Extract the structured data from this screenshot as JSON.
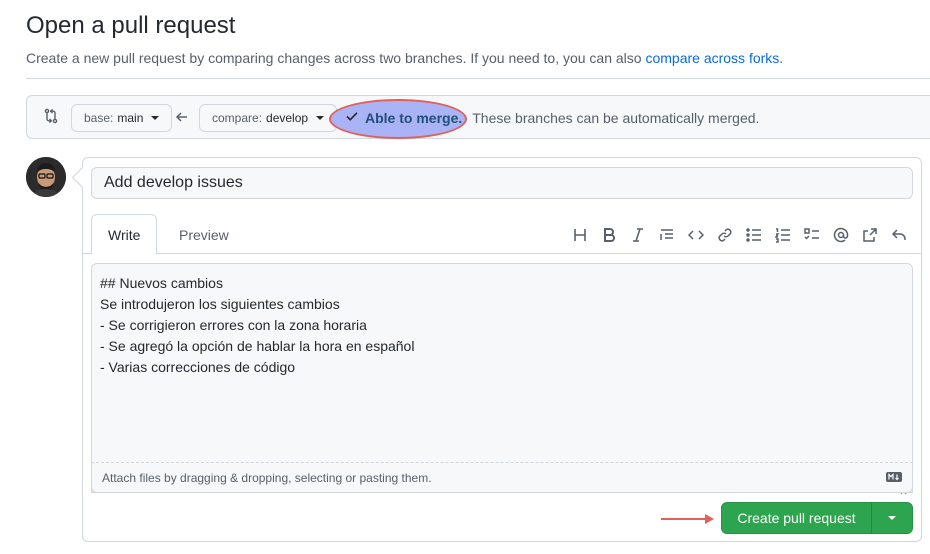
{
  "header": {
    "title": "Open a pull request",
    "subtitle_text": "Create a new pull request by comparing changes across two branches. If you need to, you can also ",
    "subtitle_link": "compare across forks",
    "subtitle_end": "."
  },
  "compare_bar": {
    "base_label": "base:",
    "base_value": "main",
    "compare_label": "compare:",
    "compare_value": "develop",
    "merge_status": "Able to merge.",
    "merge_message": "These branches can be automatically merged."
  },
  "form": {
    "title_value": "Add develop issues",
    "tabs": [
      {
        "label": "Write"
      },
      {
        "label": "Preview"
      }
    ],
    "body_lines": [
      "## Nuevos cambios",
      "Se introdujeron los siguientes cambios",
      "- Se corrigieron errores con la zona horaria",
      "- Se agregó la opción de hablar la hora en español",
      "- Varias correcciones de código"
    ],
    "attach_text": "Attach files by dragging & dropping, selecting or pasting them.",
    "create_label": "Create pull request"
  },
  "toolbar_icons": [
    "heading-icon",
    "bold-icon",
    "italic-icon",
    "quote-icon",
    "code-icon",
    "link-icon",
    "unordered-list-icon",
    "ordered-list-icon",
    "task-list-icon",
    "mention-icon",
    "reference-icon",
    "reply-icon"
  ],
  "colors": {
    "accent": "#0969da",
    "success": "#2da44e",
    "highlight": "#a9b3f5",
    "annotation": "#e0605a"
  }
}
